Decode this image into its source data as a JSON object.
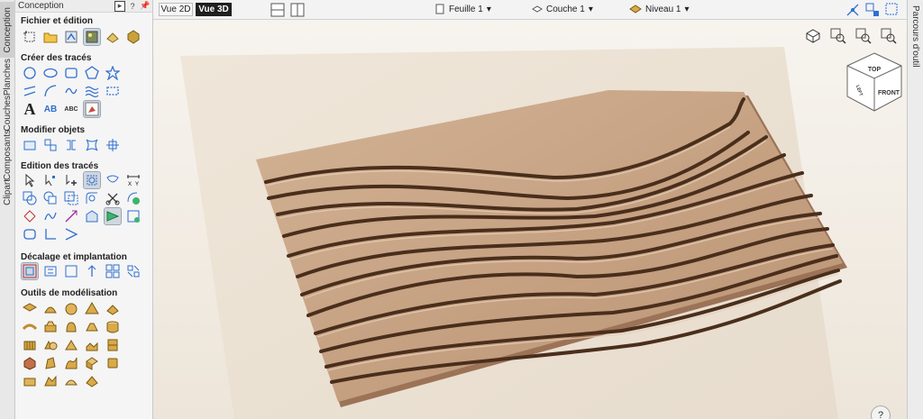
{
  "left_tabs": [
    "Conception",
    "Planches",
    "Couches",
    "Composants",
    "Clipart"
  ],
  "panel": {
    "title": "Conception",
    "header_buttons": [
      "▸",
      "?",
      "📌"
    ],
    "sections": [
      {
        "title": "Fichier et édition"
      },
      {
        "title": "Créer des tracés"
      },
      {
        "title": "Modifier objets"
      },
      {
        "title": "Edition des tracés"
      },
      {
        "title": "Décalage et implantation"
      },
      {
        "title": "Outils de modélisation"
      }
    ],
    "text_tools": {
      "big_a": "A",
      "ab": "AB",
      "abc": "ABC"
    }
  },
  "topbar": {
    "vue2d": "Vue 2D",
    "vue3d": "Vue 3D",
    "sheet": "Feuille 1",
    "layer": "Couche 1",
    "level": "Niveau 1"
  },
  "right_strip": {
    "label": "Parcours d'outil"
  },
  "viewcube": {
    "top": "TOP",
    "front": "FRONT",
    "left": "LEFT"
  },
  "help": "?",
  "colors": {
    "accent": "#2f6fd0",
    "wood": "#c7a488",
    "dark_btn": "#1f1f1f"
  }
}
